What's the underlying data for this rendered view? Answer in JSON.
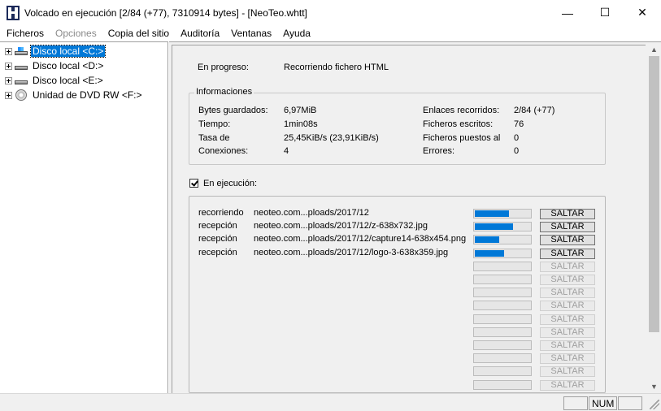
{
  "window": {
    "title": "Volcado en ejecución [2/84 (+77), 7310914 bytes] - [NeoTeo.whtt]",
    "controls": {
      "minimize": "—",
      "maximize": "☐",
      "close": "✕"
    }
  },
  "menu": {
    "items": [
      {
        "label": "Ficheros",
        "enabled": true
      },
      {
        "label": "Opciones",
        "enabled": false
      },
      {
        "label": "Copia del sitio",
        "enabled": true
      },
      {
        "label": "Auditoría",
        "enabled": true
      },
      {
        "label": "Ventanas",
        "enabled": true
      },
      {
        "label": "Ayuda",
        "enabled": true
      }
    ]
  },
  "tree": {
    "items": [
      {
        "label": "Disco local <C:>",
        "icon": "local-disk-system-icon",
        "selected": true
      },
      {
        "label": "Disco local <D:>",
        "icon": "local-disk-icon",
        "selected": false
      },
      {
        "label": "Disco local <E:>",
        "icon": "local-disk-icon",
        "selected": false
      },
      {
        "label": "Unidad de DVD RW <F:>",
        "icon": "dvd-drive-icon",
        "selected": false
      }
    ]
  },
  "progress_info": {
    "label": "En progreso:",
    "value": "Recorriendo fichero HTML"
  },
  "info_group": {
    "title": "Informaciones",
    "left": [
      {
        "label": "Bytes guardados:",
        "value": "6,97MiB"
      },
      {
        "label": "Tiempo:",
        "value": "1min08s"
      },
      {
        "label": "Tasa de",
        "value": "25,45KiB/s (23,91KiB/s)"
      },
      {
        "label": "Conexiones:",
        "value": "4"
      }
    ],
    "right": [
      {
        "label": "Enlaces recorridos:",
        "value": "2/84 (+77)"
      },
      {
        "label": "Ficheros escritos:",
        "value": "76"
      },
      {
        "label": "Ficheros puestos al",
        "value": "0"
      },
      {
        "label": "Errores:",
        "value": "0"
      }
    ]
  },
  "running": {
    "checkbox_label": "En ejecución:",
    "checked": true,
    "skip_label": "SALTAR",
    "tasks": [
      {
        "status": "recorriendo",
        "url": "neoteo.com...ploads/2017/12",
        "progress": 0.6
      },
      {
        "status": "recepción",
        "url": "neoteo.com...ploads/2017/12/z-638x732.jpg",
        "progress": 0.67
      },
      {
        "status": "recepción",
        "url": "neoteo.com...ploads/2017/12/capture14-638x454.png",
        "progress": 0.43
      },
      {
        "status": "recepción",
        "url": "neoteo.com...ploads/2017/12/logo-3-638x359.jpg",
        "progress": 0.52
      }
    ],
    "empty_slots": 10
  },
  "statusbar": {
    "num_label": "NUM"
  },
  "colors": {
    "selection": "#0078d7",
    "progress_fill": "#0078d7",
    "pane_background": "#f0f0f0"
  }
}
